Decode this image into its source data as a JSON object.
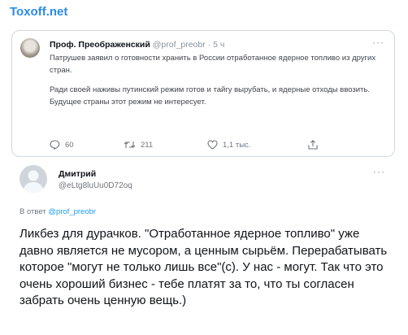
{
  "channel": {
    "title": "Toxoff.net"
  },
  "quoted_tweet": {
    "author_name": "Проф. Преображенский",
    "author_handle": "@prof_preobr",
    "separator": "·",
    "time": "5 ч",
    "more": "···",
    "paragraph1": "Патрушев заявил о готовности хранить в России отработанное ядерное топливо из других стран.",
    "paragraph2_line1": "Ради своей наживы путинский режим готов и тайгу вырубать, и ядерные отходы ввозить.",
    "paragraph2_line2": "Будущее страны этот режим не интересует.",
    "replies_count": "60",
    "retweets_count": "211",
    "likes_count": "1,1 тыс.",
    "icons": [
      "reply-icon",
      "retweet-icon",
      "like-icon",
      "share-icon"
    ]
  },
  "reply_tweet": {
    "author_name": "Дмитрий",
    "author_handle": "@eLtg8luUu0D72oq",
    "more": "···",
    "reply_to_prefix": "В ответ",
    "reply_to_handle": "@prof_preobr",
    "text": "Ликбез для дурачков. \"Отработанное ядерное топливо\" уже давно является не мусором, а ценным сырьём. Перерабатывать которое \"могут не только лишь все\"(с). У нас - могут. Так что это очень хороший бизнес - тебе платят за то, что ты согласен забрать очень ценную вещь.)"
  },
  "colors": {
    "channel_title": "#2b8ce8",
    "link": "#1d9bf0",
    "border": "#cfd9de",
    "muted": "#6e767d"
  }
}
